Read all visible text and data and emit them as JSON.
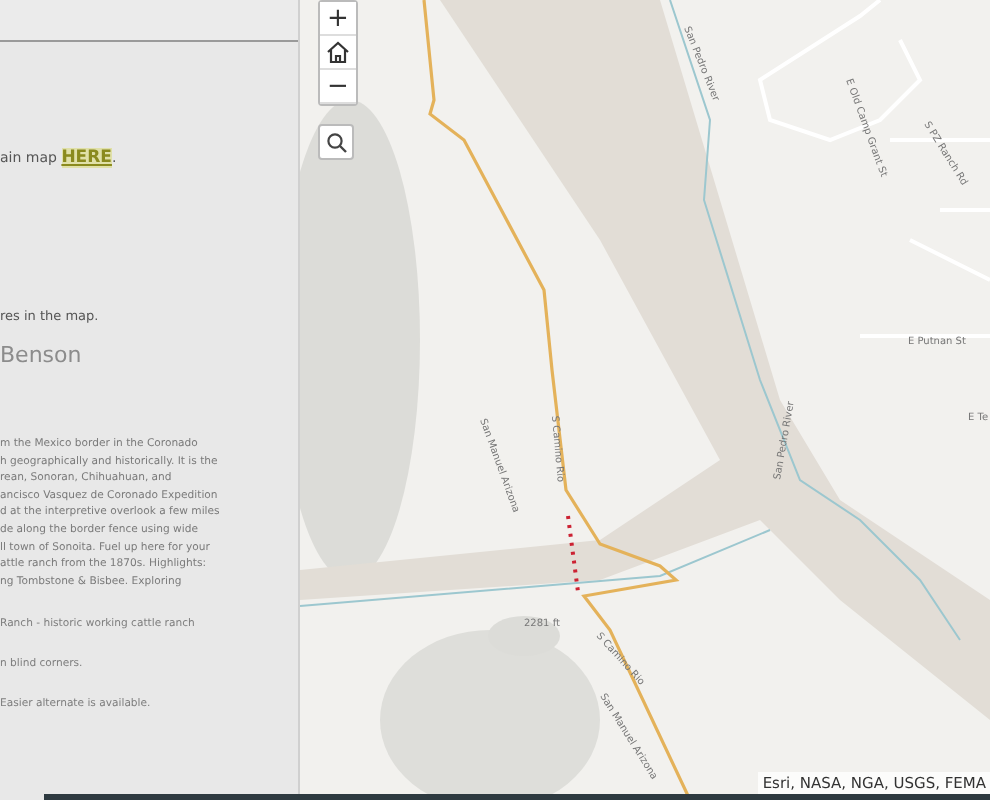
{
  "panel": {
    "link_line": {
      "before": "ain map ",
      "link": "HERE",
      "after": "."
    },
    "note": "res in the map.",
    "heading": "Benson",
    "paragraph": "m the Mexico border in the Coronado\nh geographically and historically. It is the\nrean, Sonoran, Chihuahuan, and\nancisco Vasquez de Coronado Expedition\nd at the interpretive overlook a few miles\nde along the border fence using wide\nll town of Sonoita. Fuel up here for your\nattle ranch from the 1870s. Highlights:\nng Tombstone & Bisbee. Exploring",
    "items": [
      "Ranch - historic working cattle ranch",
      "n blind corners.",
      "Easier alternate is available."
    ]
  },
  "map": {
    "controls": [
      {
        "kind": "zoom-in",
        "label": "+"
      },
      {
        "kind": "home"
      },
      {
        "kind": "zoom-out",
        "label": "−"
      }
    ],
    "labels": [
      "E Old Camp Grant St",
      "S PZ Ranch Rd",
      "San Pedro River",
      "E Putnan St",
      "E Te",
      "S Camino Rio",
      "San Manuel Arizona",
      "San Pedro River",
      "2281 ft",
      "S Camino Rio",
      "San Manuel Arizona"
    ],
    "attribution": "Esri, NASA, NGA, USGS, FEMA"
  }
}
